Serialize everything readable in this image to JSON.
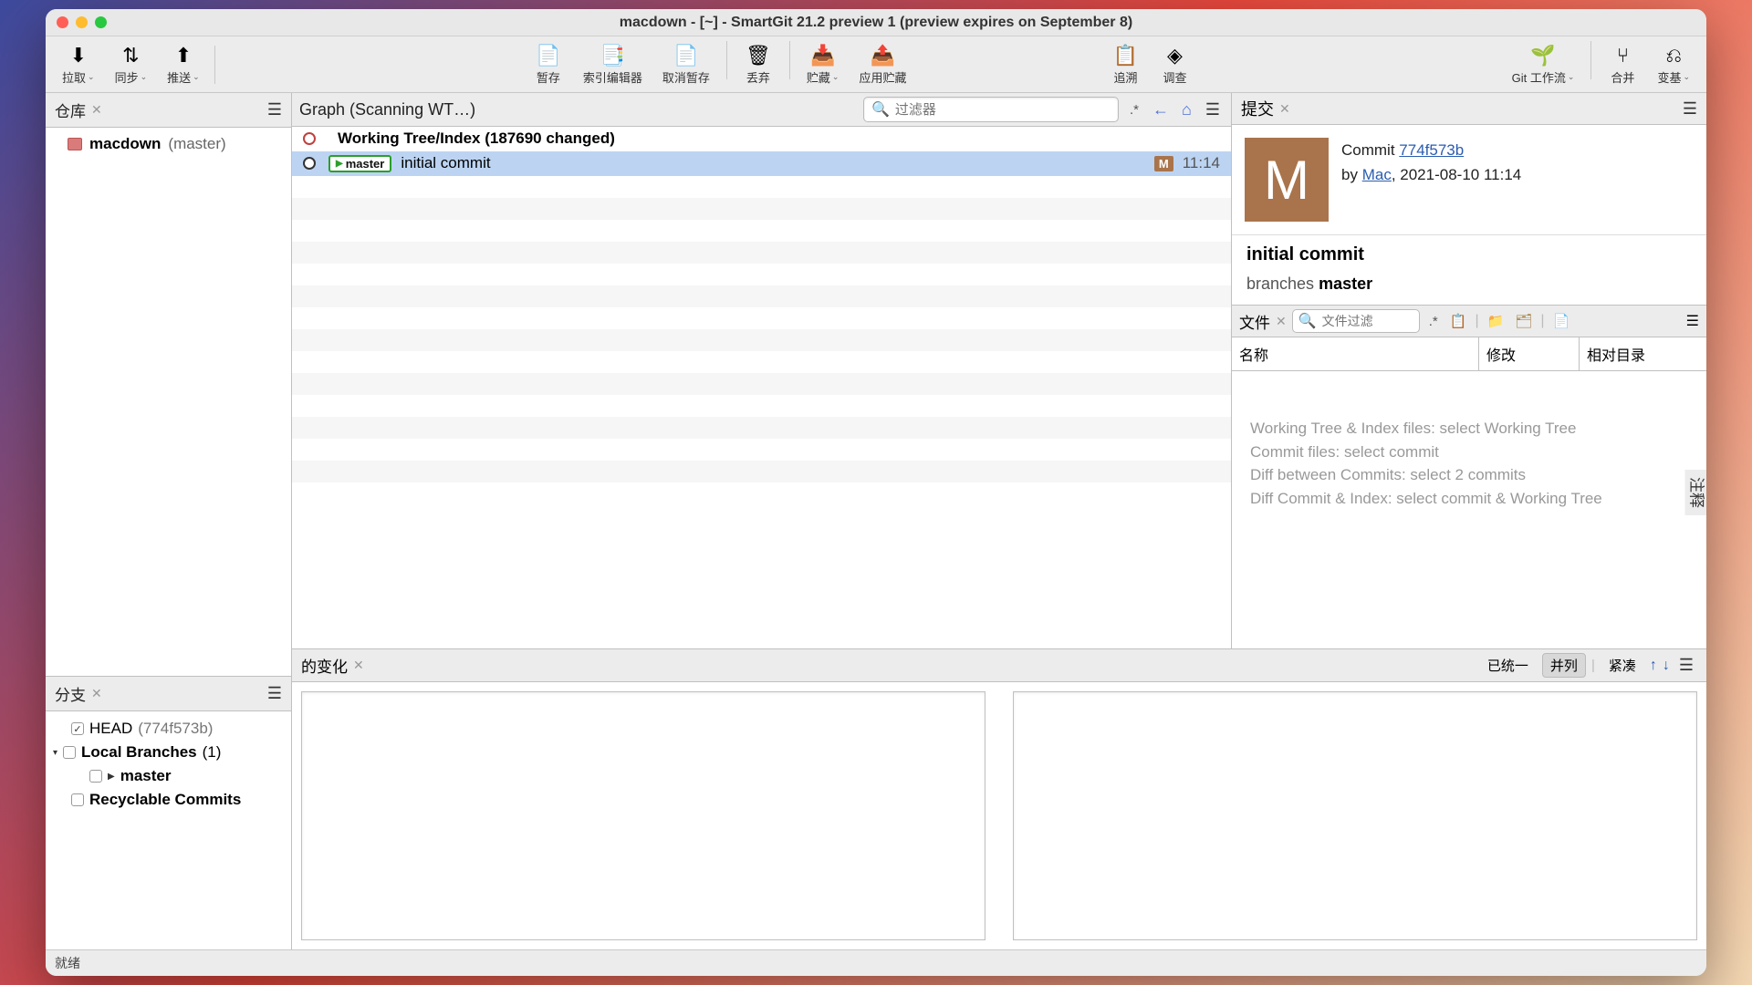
{
  "window": {
    "title": "macdown - [~] - SmartGit 21.2 preview 1 (preview expires on September 8)"
  },
  "toolbar": {
    "pull": "拉取",
    "sync": "同步",
    "push": "推送",
    "stash": "暂存",
    "indexEditor": "索引编辑器",
    "unstash": "取消暂存",
    "discard": "丢弃",
    "stashSave": "贮藏",
    "applyStash": "应用贮藏",
    "blame": "追溯",
    "investigate": "调查",
    "gitflow": "Git 工作流",
    "merge": "合并",
    "rebase": "变基"
  },
  "panels": {
    "repos": "仓库",
    "graph": "Graph (Scanning WT…)",
    "branches": "分支",
    "commit": "提交",
    "files": "文件",
    "changes": "的变化",
    "notes": "注释"
  },
  "repo": {
    "name": "macdown",
    "branch": "(master)"
  },
  "branchTree": {
    "head": "HEAD",
    "headHash": "(774f573b)",
    "localBranches": "Local Branches",
    "localCount": "(1)",
    "master": "master",
    "recyclable": "Recyclable Commits"
  },
  "search": {
    "placeholder": "过滤器",
    "regex": ".*"
  },
  "graph": {
    "rows": [
      {
        "msg": "Working Tree/Index (187690 changed)",
        "time": "",
        "wt": true
      },
      {
        "tag": "master",
        "msg": "initial commit",
        "badge": "M",
        "time": "11:14",
        "selected": true
      }
    ]
  },
  "commit": {
    "labelCommit": "Commit",
    "hash": "774f573b",
    "byLabel": "by",
    "author": "Mac",
    "date": ", 2021-08-10 11:14",
    "message": "initial commit",
    "branchesLabel": "branches",
    "branches": "master",
    "avatar": "M"
  },
  "files": {
    "placeholder": "文件过滤",
    "regex": ".*",
    "colName": "名称",
    "colMod": "修改",
    "colRel": "相对目录",
    "hints": [
      "Working Tree & Index files: select Working Tree",
      "Commit files: select commit",
      "Diff between Commits: select 2 commits",
      "Diff Commit & Index: select commit & Working Tree"
    ]
  },
  "diff": {
    "unified": "已统一",
    "sideBySide": "并列",
    "compact": "紧凑"
  },
  "status": "就绪"
}
